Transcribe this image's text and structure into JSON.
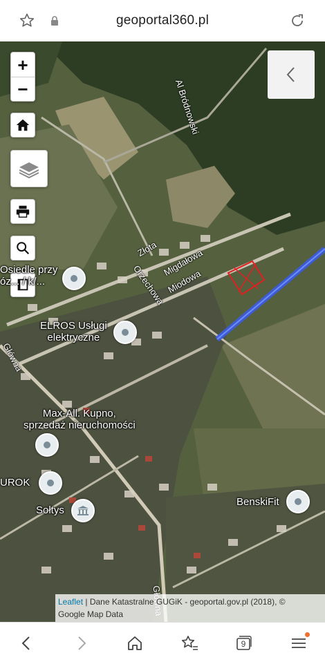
{
  "browser": {
    "url": "geoportal360.pl"
  },
  "map_controls": {
    "zoom_in": "+",
    "zoom_out": "−"
  },
  "streets": {
    "brodnowski": "Al Bródnowski",
    "zlota": "Złota",
    "migdalowa": "Migdałowa",
    "miodowa": "Miodowa",
    "orzechowa": "Orzechowa",
    "glowna_top": "Główna",
    "glowna_bottom": "Główna"
  },
  "places": {
    "osiedle_line1": "Osiedle przy",
    "osiedle_line2": "óz... / k/...",
    "elros_line1": "ELROS Usługi",
    "elros_line2": "elektryczne",
    "max_line1": "Max-All. Kupno,",
    "max_line2": "sprzedaż nieruchomości",
    "urok": "UROK",
    "soltys": "Sołtys",
    "benskifit": "BenskiFit"
  },
  "attribution": {
    "leaflet": "Leaflet",
    "line1_rest": " | Dane Katastralne GUGiK - geoportal.gov.pl (2018), ©",
    "line2": "Google Map Data"
  },
  "nav": {
    "tab_count": "9"
  },
  "colors": {
    "parcel_red": "#e02020",
    "highlight_blue": "#3b5ce0",
    "notification_dot": "#f07030",
    "attribution_link": "#0078a8"
  }
}
